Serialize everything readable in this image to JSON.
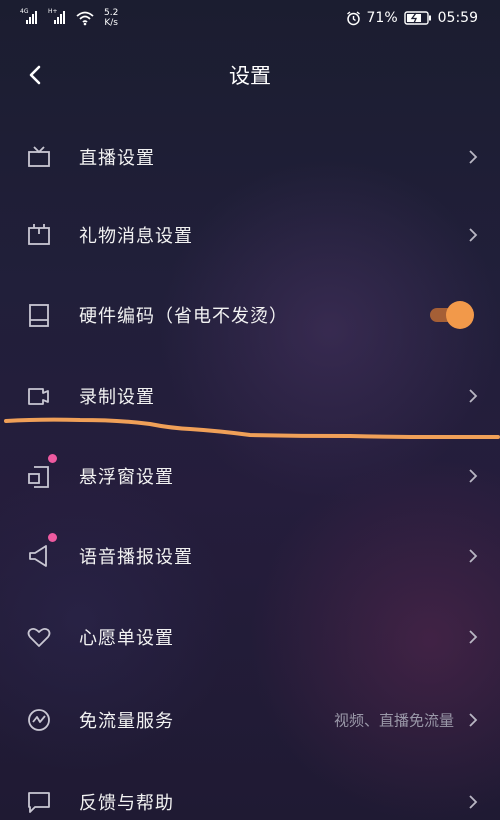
{
  "status_bar": {
    "signal1_tag": "4G",
    "signal2_tag": "H+",
    "net_speed_value": "5.2",
    "net_speed_unit": "K/s",
    "battery_percent": "71%",
    "time": "05:59"
  },
  "header": {
    "title": "设置"
  },
  "settings": {
    "items": [
      {
        "label": "直播设置"
      },
      {
        "label": "礼物消息设置"
      },
      {
        "label": "硬件编码（省电不发烫）",
        "toggle_on": true
      },
      {
        "label": "录制设置"
      },
      {
        "label": "悬浮窗设置",
        "has_new_dot": true
      },
      {
        "label": "语音播报设置",
        "has_new_dot": true
      },
      {
        "label": "心愿单设置"
      },
      {
        "label": "免流量服务",
        "hint": "视频、直播免流量"
      },
      {
        "label": "反馈与帮助"
      }
    ]
  },
  "colors": {
    "accent_orange": "#f2994a",
    "new_dot": "#ee5aa0",
    "annotation": "#f0a058"
  },
  "icons": [
    "tv-icon",
    "gift-box-icon",
    "tablet-icon",
    "camera-record-icon",
    "floating-window-icon",
    "speaker-icon",
    "heart-icon",
    "data-wave-icon",
    "chat-icon"
  ]
}
